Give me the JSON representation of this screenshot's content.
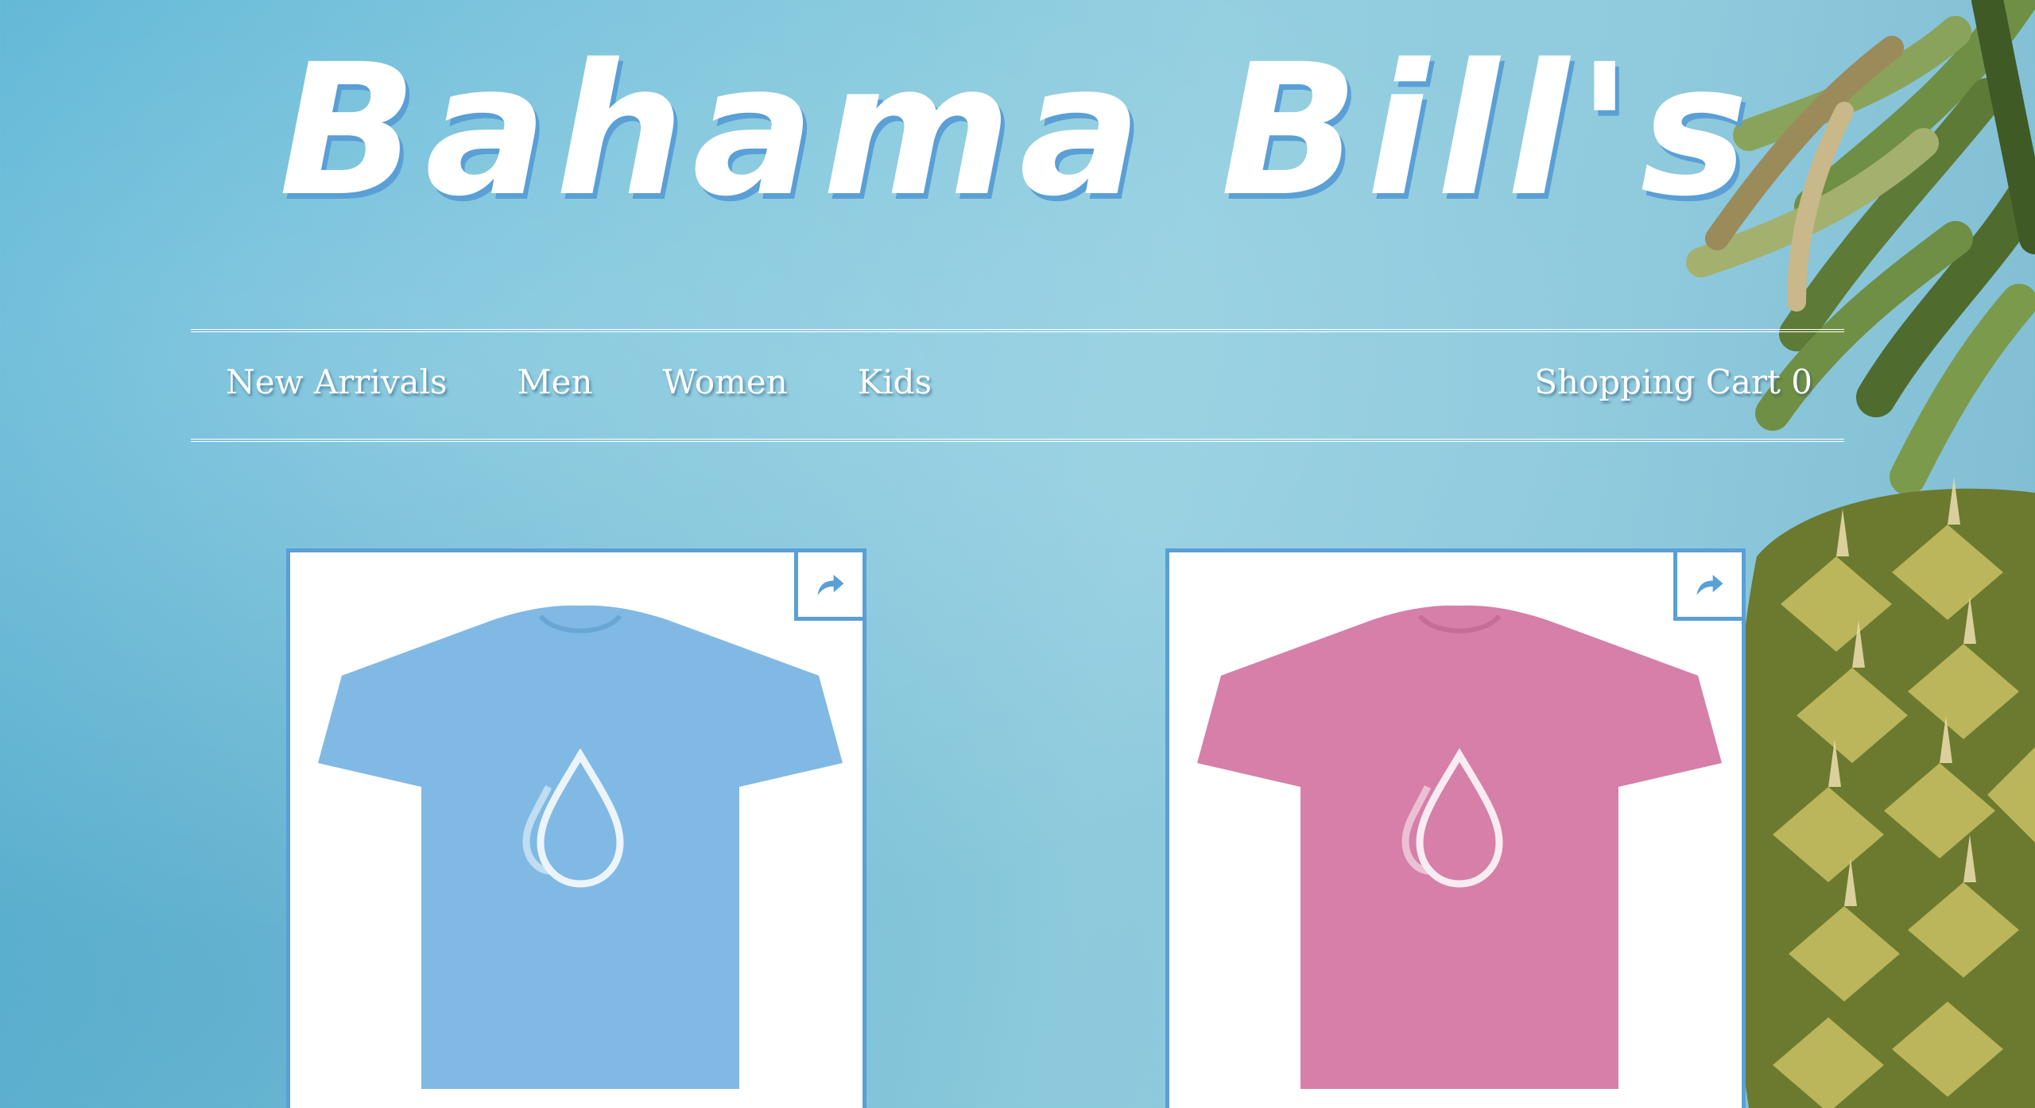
{
  "brand": {
    "title": "Bahama  Bill's",
    "shadow_color": "#5a9fd6"
  },
  "nav": {
    "items": [
      {
        "label": "New Arrivals"
      },
      {
        "label": "Men"
      },
      {
        "label": "Women"
      },
      {
        "label": "Kids"
      }
    ],
    "cart_label": "Shopping Cart 0"
  },
  "products": [
    {
      "shirt_color": "#80b9e4",
      "share_icon": "share-icon"
    },
    {
      "shirt_color": "#d67fa8",
      "share_icon": "share-icon"
    }
  ],
  "colors": {
    "accent": "#5a9fd6",
    "background": "#8fcadd",
    "text": "#ffffff"
  }
}
